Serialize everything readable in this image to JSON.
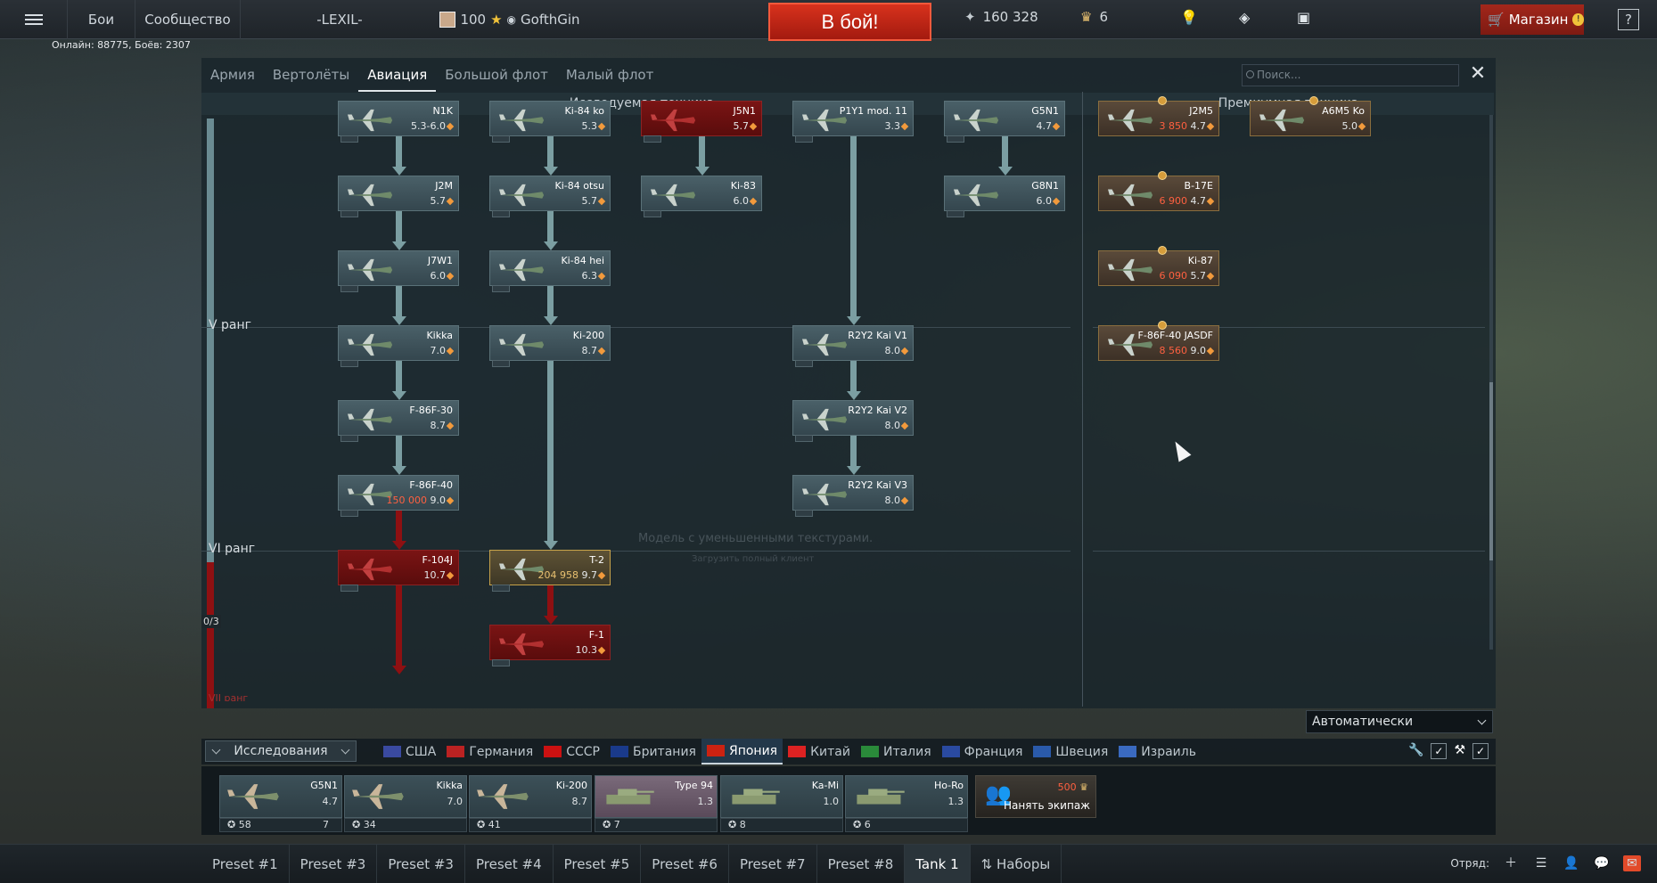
{
  "topbar": {
    "menu_1": "Бои",
    "menu_2": "Сообщество",
    "squad_tag": "-LEXIL-",
    "rank_level": "100",
    "username": "GofthGin",
    "battle_button": "В бой!",
    "silver_lions": "160 328",
    "golden_eagles": "6",
    "shop_label": "Магазин",
    "help": "?"
  },
  "online_text": "Онлайн: 88775, Боёв: 2307",
  "tabs": [
    "Армия",
    "Вертолёты",
    "Авиация",
    "Большой флот",
    "Малый флот"
  ],
  "active_tab": "Авиация",
  "search": {
    "placeholder": "Поиск..."
  },
  "sections": {
    "researched": "Исследуемая техника",
    "premium": "Премиумная техника"
  },
  "ranks": {
    "rank5": "V ранг",
    "rank6": "VI ранг",
    "rank7": "VII ранг",
    "rank7_count": "0/3"
  },
  "vehicles": [
    {
      "id": "n1k",
      "name": "N1K",
      "br": "5.3-6.0",
      "style": "normal"
    },
    {
      "id": "ki84ko",
      "name": "Ki-84 ko",
      "br": "5.3",
      "style": "normal"
    },
    {
      "id": "j5n1",
      "name": "J5N1",
      "br": "5.7",
      "style": "red"
    },
    {
      "id": "p1y1",
      "name": "P1Y1 mod. 11",
      "br": "3.3",
      "style": "normal"
    },
    {
      "id": "g5n1",
      "name": "G5N1",
      "br": "4.7",
      "style": "normal"
    },
    {
      "id": "j2m",
      "name": "J2M",
      "br": "5.7",
      "style": "normal"
    },
    {
      "id": "ki84otsu",
      "name": "Ki-84 otsu",
      "br": "5.7",
      "style": "normal"
    },
    {
      "id": "ki83",
      "name": "Ki-83",
      "br": "6.0",
      "style": "normal"
    },
    {
      "id": "g8n1",
      "name": "G8N1",
      "br": "6.0",
      "style": "normal"
    },
    {
      "id": "j7w1",
      "name": "J7W1",
      "br": "6.0",
      "style": "normal"
    },
    {
      "id": "ki84hei",
      "name": "Ki-84 hei",
      "br": "6.3",
      "style": "normal"
    },
    {
      "id": "kikka",
      "name": "Kikka",
      "br": "7.0",
      "style": "normal"
    },
    {
      "id": "ki200",
      "name": "Ki-200",
      "br": "8.7",
      "style": "normal"
    },
    {
      "id": "r2y2v1",
      "name": "R2Y2 Kai V1",
      "br": "8.0",
      "style": "normal"
    },
    {
      "id": "f86f30",
      "name": "F-86F-30",
      "br": "8.7",
      "style": "normal"
    },
    {
      "id": "r2y2v2",
      "name": "R2Y2 Kai V2",
      "br": "8.0",
      "style": "normal"
    },
    {
      "id": "f86f40",
      "name": "F-86F-40",
      "br": "9.0",
      "cost": "150 000",
      "style": "normal"
    },
    {
      "id": "r2y2v3",
      "name": "R2Y2 Kai V3",
      "br": "8.0",
      "style": "normal"
    },
    {
      "id": "f104j",
      "name": "F-104J",
      "br": "10.7",
      "style": "red"
    },
    {
      "id": "t2",
      "name": "T-2",
      "br": "9.7",
      "rp": "204 958",
      "style": "gold"
    },
    {
      "id": "f1",
      "name": "F-1",
      "br": "10.3",
      "style": "red"
    }
  ],
  "premium": [
    {
      "id": "j2m5",
      "name": "J2M5",
      "br": "4.7",
      "cost": "3 850"
    },
    {
      "id": "a6m5ko",
      "name": "A6M5 Ko",
      "br": "5.0",
      "cost": ""
    },
    {
      "id": "b17e",
      "name": "B-17E",
      "br": "4.7",
      "cost": "6 900"
    },
    {
      "id": "ki87",
      "name": "Ki-87",
      "br": "5.7",
      "cost": "6 090"
    },
    {
      "id": "f86f40jasdf",
      "name": "F-86F-40 JASDF",
      "br": "9.0",
      "cost": "8 560"
    }
  ],
  "watermark": {
    "line1": "Модель с уменьшенными текстурами.",
    "line2": "Загрузить полный клиент"
  },
  "mode_select": "Автоматически",
  "research_button": "Исследования",
  "nations": [
    "США",
    "Германия",
    "СССР",
    "Британия",
    "Япония",
    "Китай",
    "Италия",
    "Франция",
    "Швеция",
    "Израиль"
  ],
  "active_nation": "Япония",
  "crew_slots": [
    {
      "name": "G5N1",
      "br": "4.7",
      "crew": "58",
      "extra": "7"
    },
    {
      "name": "Kikka",
      "br": "7.0",
      "crew": "34",
      "extra": ""
    },
    {
      "name": "Ki-200",
      "br": "8.7",
      "crew": "41",
      "extra": ""
    },
    {
      "name": "Type 94",
      "br": "1.3",
      "crew": "7",
      "extra": ""
    },
    {
      "name": "Ka-Mi",
      "br": "1.0",
      "crew": "8",
      "extra": ""
    },
    {
      "name": "Ho-Ro",
      "br": "1.3",
      "crew": "6",
      "extra": ""
    }
  ],
  "hire_crew": {
    "cost": "500",
    "label": "Нанять экипаж"
  },
  "presets": [
    "Preset #1",
    "Preset #3",
    "Preset #3",
    "Preset #4",
    "Preset #5",
    "Preset #6",
    "Preset #7",
    "Preset #8",
    "Tank 1",
    "Наборы"
  ],
  "active_preset": "Tank 1",
  "squad_label": "Отряд:",
  "colors": {
    "battle": "#c8261a",
    "research_line": "#7b9ea2",
    "locked": "#8e1012",
    "accent": "#f29a3c"
  }
}
